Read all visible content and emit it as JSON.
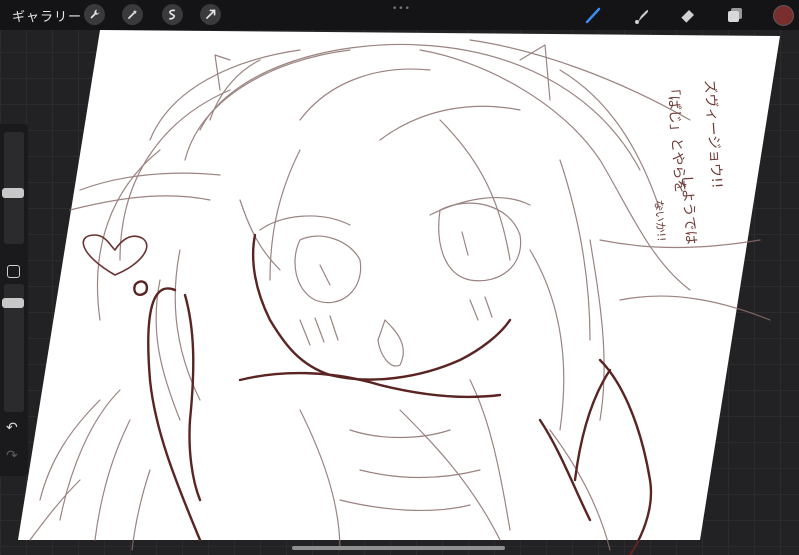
{
  "toolbar": {
    "gallery_label": "ギャラリー",
    "left_tools": [
      "wrench-icon",
      "magic-wand-icon",
      "selection-icon",
      "transform-arrow-icon"
    ],
    "right_tools": [
      "brush-icon",
      "smudge-icon",
      "eraser-icon",
      "layers-icon"
    ],
    "active_tool": "brush-icon",
    "current_color": "#7a2d2d",
    "more_indicator": "•••"
  },
  "sidebar": {
    "brush_size_level": 0.45,
    "opacity_level": 0.12,
    "undo_symbol": "↶",
    "redo_symbol": "↷"
  },
  "canvas": {
    "background": "#ffffff",
    "sketch_color_light": "#8a6e6b",
    "sketch_color_dark": "#5a2422",
    "annotation_lines": [
      "ズヴィージョウ!!",
      "「ぱじ」とやらを",
      "しようでは",
      "ないか!!"
    ]
  }
}
